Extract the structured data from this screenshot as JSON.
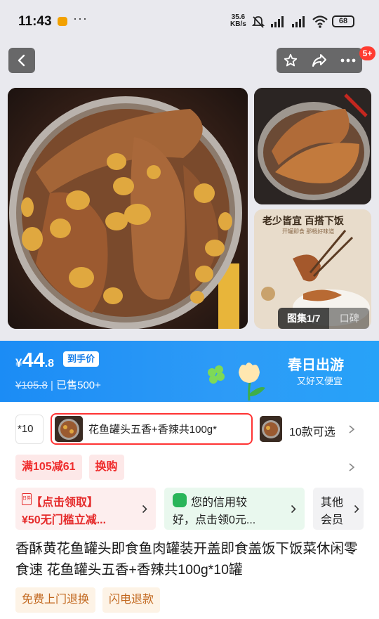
{
  "status_bar": {
    "time": "11:43",
    "more": "···",
    "net_speed_value": "35.6",
    "net_speed_unit": "KB/s",
    "battery": "68"
  },
  "header": {
    "cart_badge": "5+"
  },
  "gallery": {
    "thumb2_title": "老少皆宜  百搭下饭",
    "thumb2_subtitle": "开罐即食  那畅好味道",
    "tab_album": "图集1/7",
    "tab_review": "口碑"
  },
  "price": {
    "currency": "¥",
    "integer": "44",
    "decimal": ".8",
    "tag": "到手价",
    "original": "¥105.8",
    "separator": " | ",
    "sold": "已售500+",
    "promo_title": "春日出游",
    "promo_subtitle": "又好又便宜",
    "accent_color": "#1b8cf5"
  },
  "sku": {
    "partial_label": "*10",
    "selected_label": "花鱼罐头五香+香辣共100g*",
    "count_label": "10款可选"
  },
  "coupons": [
    "满105减61",
    "换购"
  ],
  "cards": {
    "red": {
      "icon_text": "日券",
      "line1": "【点击领取】",
      "line2": "¥50无门槛立减..."
    },
    "green": {
      "line1": "您的信用较",
      "line2": "好，点击领0元..."
    },
    "gray": {
      "line1": "其他",
      "line2": "会员"
    }
  },
  "product_title": "香酥黄花鱼罐头即食鱼肉罐装开盖即食盖饭下饭菜休闲零食速 花鱼罐头五香+香辣共100g*10罐",
  "services": [
    "免费上门退换",
    "闪电退款"
  ]
}
